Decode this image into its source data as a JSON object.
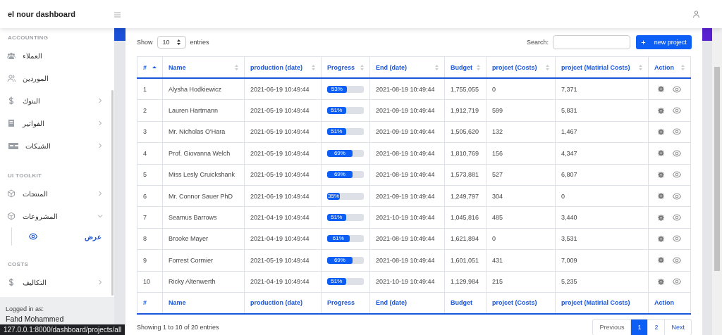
{
  "topbar": {
    "title": "el nour dashboard"
  },
  "sidebar": {
    "sections": [
      {
        "label": "ACCOUNTING",
        "items": [
          {
            "label": "العملاء"
          },
          {
            "label": "الموردين"
          },
          {
            "label": "البنوك",
            "expanded": false
          },
          {
            "label": "الفواتير",
            "expanded": false
          },
          {
            "label": "الشيكات",
            "expanded": false
          }
        ]
      },
      {
        "label": "UI TOOLKIT",
        "items": [
          {
            "label": "المنتجات",
            "expanded": false
          },
          {
            "label": "المشروعات",
            "expanded": true,
            "children": [
              {
                "label": "عرض"
              }
            ]
          }
        ]
      },
      {
        "label": "COSTS",
        "items": [
          {
            "label": "التكاليف",
            "expanded": false
          }
        ]
      }
    ],
    "footer": {
      "caption": "Logged in as:",
      "user": "Fahd Mohammed"
    }
  },
  "controls": {
    "show": "Show",
    "page_size": "10",
    "entries": "entries",
    "search_label": "Search:",
    "new_button_icon": "+",
    "new_button": "new project"
  },
  "table": {
    "columns": [
      {
        "label": "#",
        "sorted": true
      },
      {
        "label": "Name",
        "sorted": false
      },
      {
        "label": "production (date)",
        "sorted": false
      },
      {
        "label": "Progress",
        "sorted": false
      },
      {
        "label": "End (date)",
        "sorted": false
      },
      {
        "label": "Budget",
        "sorted": false
      },
      {
        "label": "projcet (Costs)",
        "sorted": false
      },
      {
        "label": "projcet (Matirial Costs)",
        "sorted": false
      },
      {
        "label": "Action",
        "sorted": false
      }
    ],
    "rows": [
      {
        "id": "1",
        "name": "Alysha Hodkiewicz",
        "production": "2021-06-19 10:49:44",
        "progress": "53%",
        "level": 0.53,
        "end": "2021-08-19 10:49:44",
        "budget": "1,755,055",
        "costs": "0",
        "material": "7,371"
      },
      {
        "id": "2",
        "name": "Lauren Hartmann",
        "production": "2021-05-19 10:49:44",
        "progress": "51%",
        "level": 0.51,
        "end": "2021-09-19 10:49:44",
        "budget": "1,912,719",
        "costs": "599",
        "material": "5,831"
      },
      {
        "id": "3",
        "name": "Mr. Nicholas O'Hara",
        "production": "2021-05-19 10:49:44",
        "progress": "51%",
        "level": 0.51,
        "end": "2021-09-19 10:49:44",
        "budget": "1,505,620",
        "costs": "132",
        "material": "1,467"
      },
      {
        "id": "4",
        "name": "Prof. Giovanna Welch",
        "production": "2021-05-19 10:49:44",
        "progress": "69%",
        "level": 0.69,
        "end": "2021-08-19 10:49:44",
        "budget": "1,810,769",
        "costs": "156",
        "material": "4,347"
      },
      {
        "id": "5",
        "name": "Miss Lesly Cruickshank",
        "production": "2021-05-19 10:49:44",
        "progress": "69%",
        "level": 0.69,
        "end": "2021-08-19 10:49:44",
        "budget": "1,573,881",
        "costs": "527",
        "material": "6,807"
      },
      {
        "id": "6",
        "name": "Mr. Connor Sauer PhD",
        "production": "2021-06-19 10:49:44",
        "progress": "35%",
        "level": 0.35,
        "end": "2021-09-19 10:49:44",
        "budget": "1,249,797",
        "costs": "304",
        "material": "0"
      },
      {
        "id": "7",
        "name": "Seamus Barrows",
        "production": "2021-04-19 10:49:44",
        "progress": "51%",
        "level": 0.51,
        "end": "2021-10-19 10:49:44",
        "budget": "1,045,816",
        "costs": "485",
        "material": "3,440"
      },
      {
        "id": "8",
        "name": "Brooke Mayer",
        "production": "2021-04-19 10:49:44",
        "progress": "61%",
        "level": 0.61,
        "end": "2021-08-19 10:49:44",
        "budget": "1,621,894",
        "costs": "0",
        "material": "3,531"
      },
      {
        "id": "9",
        "name": "Forrest Cormier",
        "production": "2021-05-19 10:49:44",
        "progress": "69%",
        "level": 0.69,
        "end": "2021-08-19 10:49:44",
        "budget": "1,601,051",
        "costs": "431",
        "material": "7,009"
      },
      {
        "id": "10",
        "name": "Ricky Altenwerth",
        "production": "2021-04-19 10:49:44",
        "progress": "51%",
        "level": 0.51,
        "end": "2021-10-19 10:49:44",
        "budget": "1,129,984",
        "costs": "215",
        "material": "5,235"
      }
    ],
    "footer_columns": [
      "#",
      "Name",
      "production (date)",
      "Progress",
      "End (date)",
      "Budget",
      "projcet (Costs)",
      "projcet (Matirial Costs)",
      "Action"
    ]
  },
  "info": "Showing 1 to 10 of 20 entries",
  "pagination": [
    {
      "label": "Previous",
      "selected": false
    },
    {
      "label": "1",
      "selected": true
    },
    {
      "label": "2",
      "selected": false
    },
    {
      "label": "Next",
      "selected": false
    }
  ],
  "status_url": "127.0.0.1:8000/dashboard/projects/all"
}
